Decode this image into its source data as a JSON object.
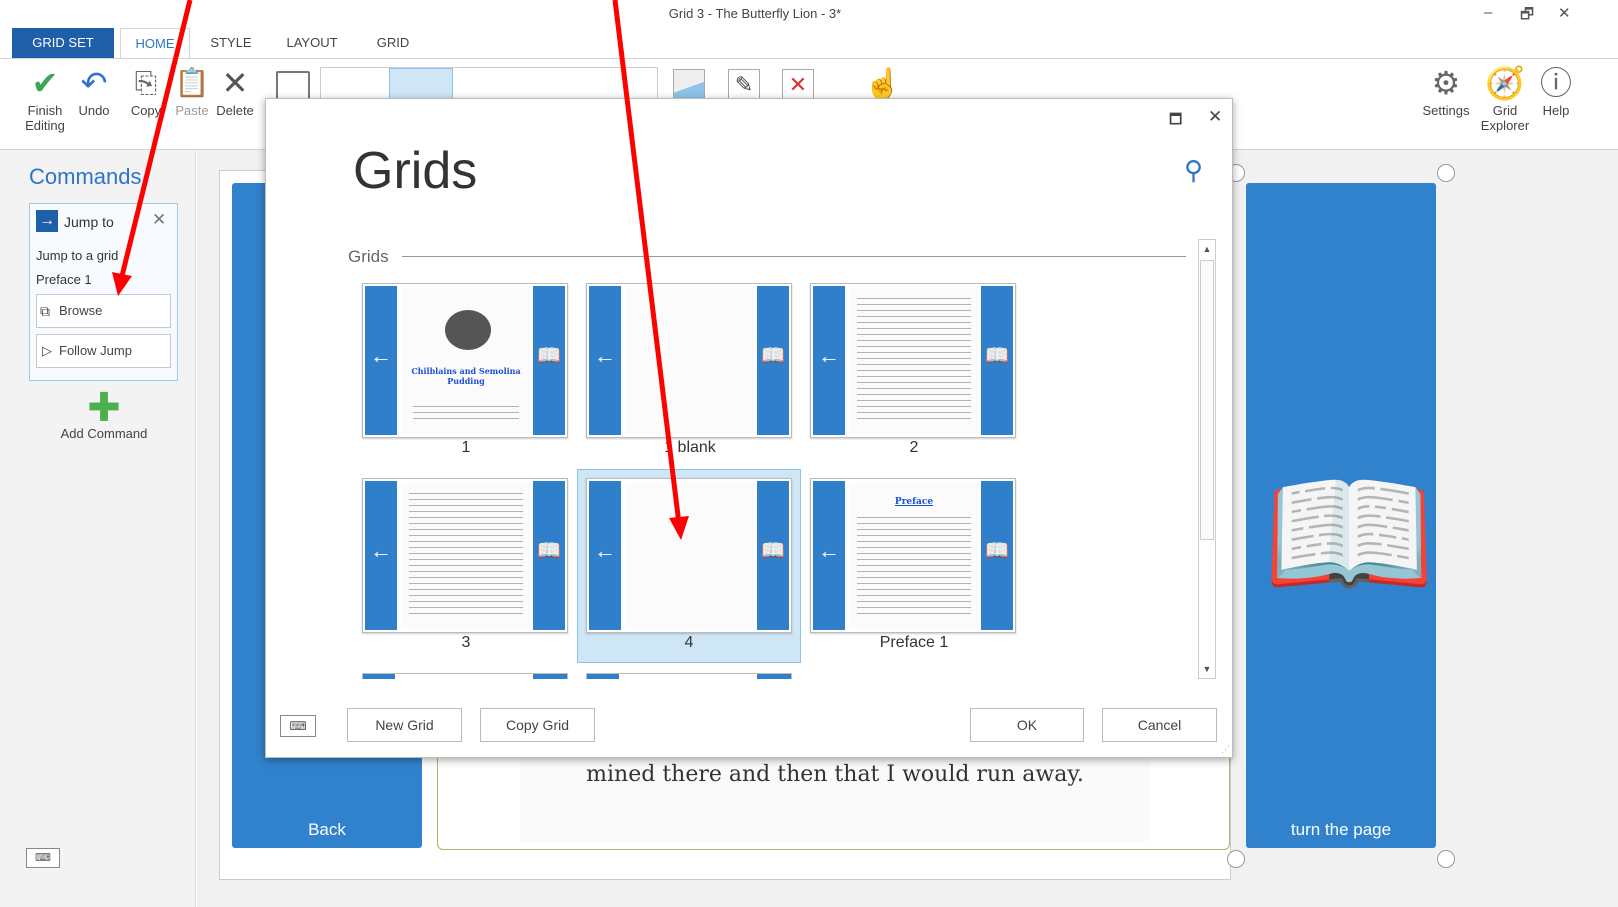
{
  "window": {
    "title": "Grid 3 - The Butterfly Lion - 3*",
    "minimize": "–",
    "restore": "🗗",
    "close": "✕"
  },
  "tabs": [
    "GRID SET",
    "HOME",
    "STYLE",
    "LAYOUT",
    "GRID"
  ],
  "ribbon": {
    "finish": "Finish Editing",
    "undo": "Undo",
    "copy": "Copy",
    "paste": "Paste",
    "delete": "Delete",
    "settings": "Settings",
    "explorer": "Grid Explorer",
    "help": "Help"
  },
  "commands": {
    "title": "Commands",
    "card_title": "Jump to",
    "description": "Jump to a grid",
    "target": "Preface 1",
    "browse": "Browse",
    "follow": "Follow Jump",
    "add": "Add Command"
  },
  "canvas": {
    "back_label": "Back",
    "turn_label": "turn the page",
    "page_text": "mined there and then that I would run away."
  },
  "dialog": {
    "title": "Grids",
    "section": "Grids",
    "tiles": [
      {
        "label": "1",
        "heading": "Chilblains and Semolina Pudding"
      },
      {
        "label": "1 blank"
      },
      {
        "label": "2"
      },
      {
        "label": "3"
      },
      {
        "label": "4",
        "selected": true
      },
      {
        "label": "Preface 1",
        "heading": "Preface"
      }
    ],
    "new_grid": "New Grid",
    "copy_grid": "Copy Grid",
    "ok": "OK",
    "cancel": "Cancel"
  },
  "colors": {
    "accent": "#2e75c7",
    "cell_blue": "#3082cc",
    "annotation_arrow": "#ff0000"
  }
}
